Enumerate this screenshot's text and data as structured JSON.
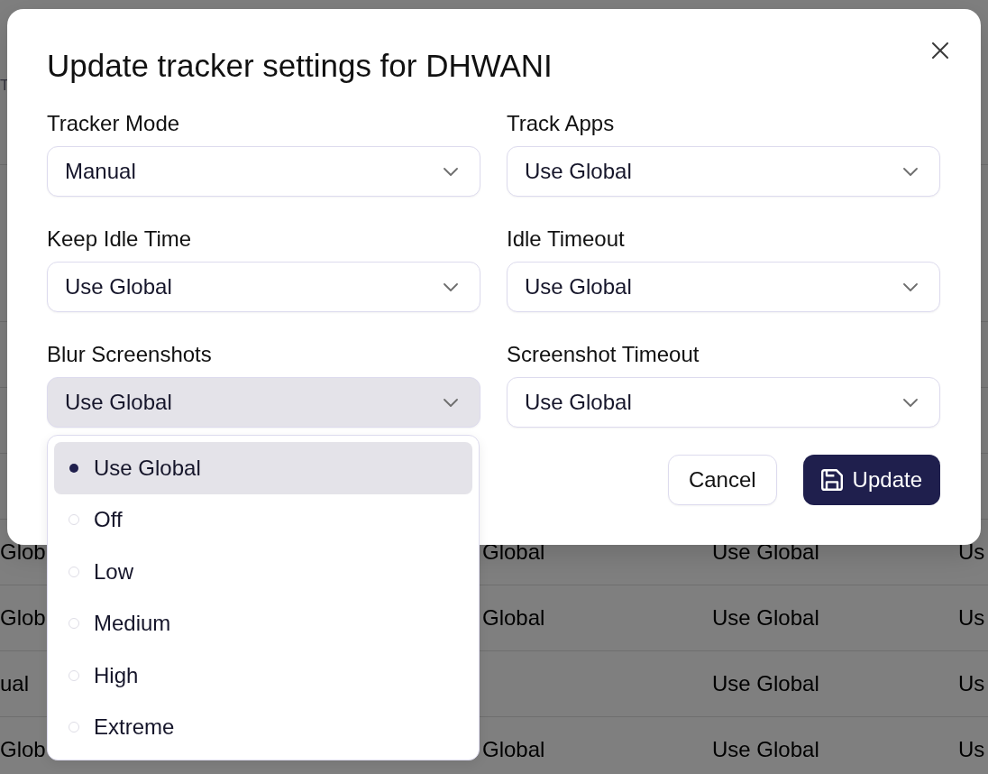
{
  "background_table": {
    "column_header": "T",
    "rows": [
      {
        "column_1": "Glob",
        "column_2": "Global",
        "column_3": "Use Global",
        "column_4": "Us"
      },
      {
        "column_1": "Glob",
        "column_2": "Global",
        "column_3": "Use Global",
        "column_4": "Us"
      },
      {
        "column_1": "ual",
        "column_3": "Use Global",
        "column_4": "Us"
      },
      {
        "column_1": "Glob",
        "column_2": "Global",
        "column_3": "Use Global",
        "column_4": "Us"
      }
    ]
  },
  "dialog": {
    "title": "Update tracker settings for DHWANI",
    "fields": [
      {
        "label": "Tracker Mode",
        "value": "Manual",
        "open": false
      },
      {
        "label": "Track Apps",
        "value": "Use Global",
        "open": false
      },
      {
        "label": "Keep Idle Time",
        "value": "Use Global",
        "open": false
      },
      {
        "label": "Idle Timeout",
        "value": "Use Global",
        "open": false
      },
      {
        "label": "Blur Screenshots",
        "value": "Use Global",
        "open": true,
        "options": [
          {
            "label": "Use Global",
            "selected": true
          },
          {
            "label": "Off",
            "selected": false
          },
          {
            "label": "Low",
            "selected": false
          },
          {
            "label": "Medium",
            "selected": false
          },
          {
            "label": "High",
            "selected": false
          },
          {
            "label": "Extreme",
            "selected": false
          }
        ]
      },
      {
        "label": "Screenshot Timeout",
        "value": "Use Global",
        "open": false
      }
    ],
    "buttons": [
      {
        "label": "Cancel",
        "kind": "secondary"
      },
      {
        "label": "Update",
        "kind": "primary"
      }
    ]
  }
}
